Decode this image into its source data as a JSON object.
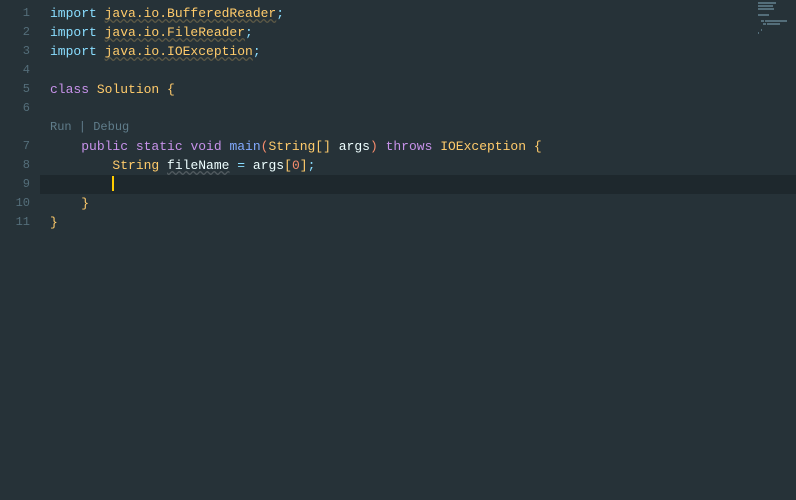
{
  "gutter": {
    "lines": [
      "1",
      "2",
      "3",
      "4",
      "5",
      "6",
      "",
      "7",
      "8",
      "9",
      "10",
      "11"
    ]
  },
  "codelens": {
    "run": "Run",
    "sep": " | ",
    "debug": "Debug"
  },
  "code": {
    "l1": {
      "import": "import ",
      "pkg": "java.io.BufferedReader",
      "semi": ";"
    },
    "l2": {
      "import": "import ",
      "pkg": "java.io.FileReader",
      "semi": ";"
    },
    "l3": {
      "import": "import ",
      "pkg": "java.io.IOException",
      "semi": ";"
    },
    "l5": {
      "class_kw": "class ",
      "name": "Solution",
      "sp": " ",
      "brace": "{"
    },
    "l7": {
      "indent": "    ",
      "public": "public ",
      "static": "static ",
      "void": "void ",
      "main": "main",
      "lp": "(",
      "String": "String",
      "lb": "[",
      "rb": "]",
      "sp": " ",
      "args": "args",
      "rp": ")",
      "sp2": " ",
      "throws": "throws ",
      "IOException": "IOException",
      "sp3": " ",
      "brace": "{"
    },
    "l8": {
      "indent": "        ",
      "String": "String",
      "sp": " ",
      "fileName": "fileName",
      "sp2": " ",
      "eq": "=",
      "sp3": " ",
      "args": "args",
      "lb": "[",
      "zero": "0",
      "rb": "]",
      "semi": ";"
    },
    "l9": {
      "indent": "        "
    },
    "l10": {
      "indent": "    ",
      "brace": "}"
    },
    "l11": {
      "brace": "}"
    }
  }
}
